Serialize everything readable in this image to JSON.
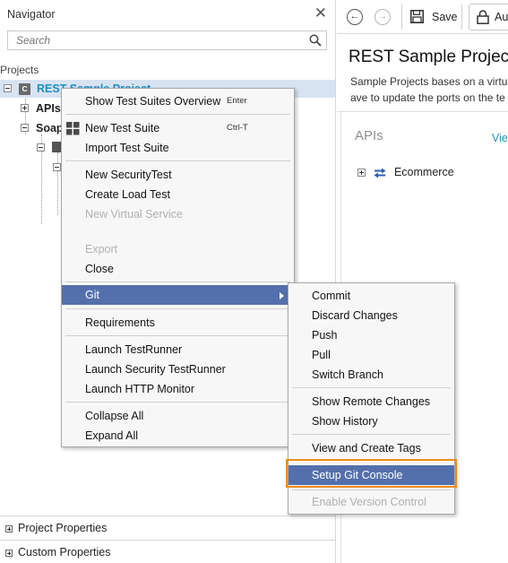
{
  "navigator": {
    "title": "Navigator",
    "search_placeholder": "Search",
    "projects_label": "Projects",
    "tree": {
      "project_name": "REST Sample Project",
      "project_badge": "C",
      "apis_label": "APIs",
      "soap_label": "Soap"
    },
    "properties": [
      "Project Properties",
      "Custom Properties"
    ]
  },
  "toolbar": {
    "back_icon": "←",
    "forward_icon": "→",
    "save_label": "Save",
    "auth_label": "Au"
  },
  "editor": {
    "title": "REST Sample Projec",
    "description_lines": [
      "Sample Projects bases on a virtu",
      "ave to update the ports on the te"
    ],
    "apis_heading": "APIs",
    "view_link": "View",
    "api_items": [
      "Ecommerce"
    ]
  },
  "context_menu": {
    "items": [
      {
        "label": "Show Test Suites Overview",
        "shortcut": "Enter"
      },
      {
        "label": "New Test Suite",
        "shortcut": "Ctrl-T"
      },
      {
        "label": "Import Test Suite",
        "shortcut": ""
      },
      {
        "label": "New SecurityTest",
        "shortcut": ""
      },
      {
        "label": "Create Load Test",
        "shortcut": ""
      },
      {
        "label": "New Virtual Service",
        "shortcut": ""
      },
      {
        "label": "Export",
        "shortcut": ""
      },
      {
        "label": "Close",
        "shortcut": ""
      },
      {
        "label": "Git",
        "shortcut": ""
      },
      {
        "label": "Requirements",
        "shortcut": ""
      },
      {
        "label": "Launch TestRunner",
        "shortcut": ""
      },
      {
        "label": "Launch Security TestRunner",
        "shortcut": ""
      },
      {
        "label": "Launch HTTP Monitor",
        "shortcut": ""
      },
      {
        "label": "Collapse All",
        "shortcut": ""
      },
      {
        "label": "Expand All",
        "shortcut": ""
      }
    ]
  },
  "git_submenu": {
    "items": [
      "Commit",
      "Discard Changes",
      "Push",
      "Pull",
      "Switch Branch",
      "Show Remote Changes",
      "Show History",
      "View and Create Tags",
      "Setup Git Console",
      "Enable Version Control"
    ]
  },
  "colors": {
    "menu_highlight": "#5470ac",
    "callout_outline": "#ef8a1c",
    "project_link": "#1b8fc4",
    "selected_row": "#d8e3f2"
  }
}
